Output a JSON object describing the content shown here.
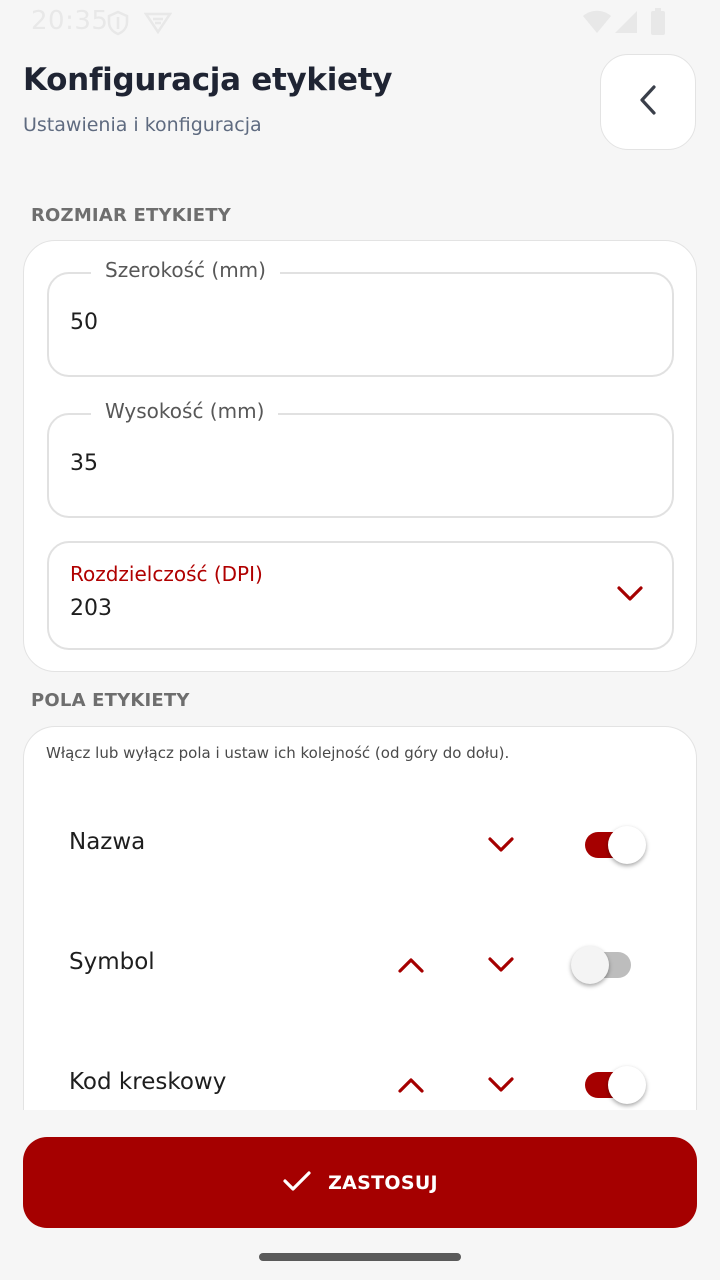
{
  "status_bar": {
    "time": "20:35"
  },
  "header": {
    "title": "Konfiguracja etykiety",
    "subtitle": "Ustawienia i konfiguracja",
    "back_icon": "chevron-left-icon"
  },
  "label_size": {
    "section_title": "ROZMIAR ETYKIETY",
    "width": {
      "label": "Szerokość (mm)",
      "value": "50"
    },
    "height": {
      "label": "Wysokość (mm)",
      "value": "35"
    },
    "resolution": {
      "label": "Rozdzielczość (DPI)",
      "value": "203"
    }
  },
  "label_fields": {
    "section_title": "POLA ETYKIETY",
    "hint": "Włącz lub wyłącz pola i ustaw ich kolejność (od góry do dołu).",
    "rows": [
      {
        "label": "Nazwa",
        "enabled": true,
        "can_move_up": false,
        "can_move_down": true
      },
      {
        "label": "Symbol",
        "enabled": false,
        "can_move_up": true,
        "can_move_down": true
      },
      {
        "label": "Kod kreskowy",
        "enabled": true,
        "can_move_up": true,
        "can_move_down": true
      }
    ]
  },
  "apply": {
    "label": "ZASTOSUJ",
    "icon": "check-icon"
  },
  "colors": {
    "accent": "#a50000",
    "background": "#f6f6f6",
    "title": "#1f2433",
    "subtitle": "#5f6b80"
  }
}
